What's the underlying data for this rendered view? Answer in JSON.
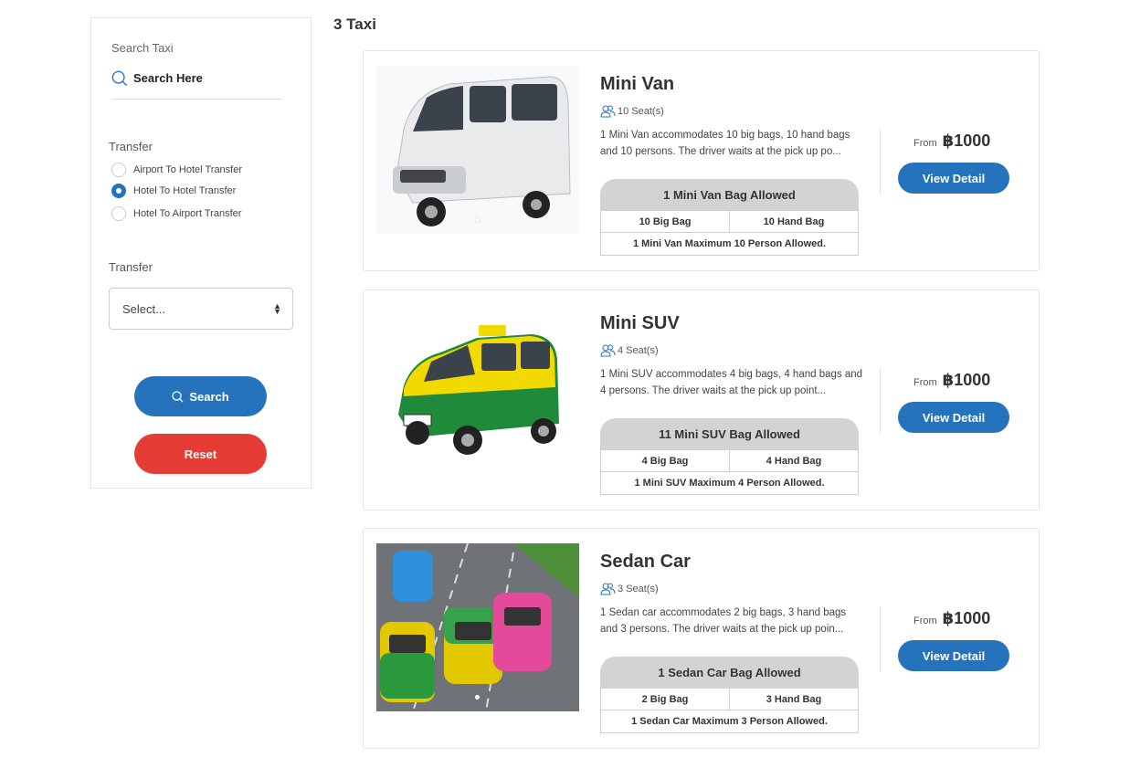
{
  "sidebar": {
    "search_label": "Search Taxi",
    "search_placeholder": "Search Here",
    "transfer_label_1": "Transfer",
    "radios": [
      {
        "label": "Airport To Hotel Transfer",
        "checked": false
      },
      {
        "label": "Hotel To Hotel Transfer",
        "checked": true
      },
      {
        "label": "Hotel To Airport Transfer",
        "checked": false
      }
    ],
    "transfer_label_2": "Transfer",
    "select_value": "Select...",
    "search_button": "Search",
    "reset_button": "Reset"
  },
  "results": {
    "count_text": "3 Taxi",
    "cards": [
      {
        "name": "Mini Van",
        "seats": "10 Seat(s)",
        "description": "1 Mini Van accommodates 10 big bags, 10 hand bags and 10 persons. The driver waits at the pick up po...",
        "bag_header": "1 Mini Van  Bag Allowed",
        "big_bag": "10 Big Bag",
        "hand_bag": "10 Hand Bag",
        "max_persons": "1 Mini Van Maximum 10 Person Allowed.",
        "from_label": "From",
        "price": "฿1000",
        "view_button": "View Detail"
      },
      {
        "name": "Mini SUV",
        "seats": "4 Seat(s)",
        "description": "1 Mini SUV accommodates 4 big bags, 4 hand bags and 4 persons. The driver waits at the pick up point...",
        "bag_header": "11 Mini SUV  Bag Allowed",
        "big_bag": "4 Big Bag",
        "hand_bag": "4 Hand Bag",
        "max_persons": "1 Mini SUV Maximum 4 Person Allowed.",
        "from_label": "From",
        "price": "฿1000",
        "view_button": "View Detail"
      },
      {
        "name": "Sedan Car",
        "seats": "3 Seat(s)",
        "description": "1 Sedan car accommodates 2 big bags, 3 hand bags and 3 persons. The driver waits at the pick up poin...",
        "bag_header": "1 Sedan Car  Bag Allowed",
        "big_bag": "2 Big Bag",
        "hand_bag": "3 Hand Bag",
        "max_persons": "1 Sedan Car Maximum 3 Person Allowed.",
        "from_label": "From",
        "price": "฿1000",
        "view_button": "View Detail"
      }
    ]
  },
  "colors": {
    "primary": "#2573bd",
    "reset": "#e53c35",
    "bag_header_bg": "#d3d3d3"
  }
}
